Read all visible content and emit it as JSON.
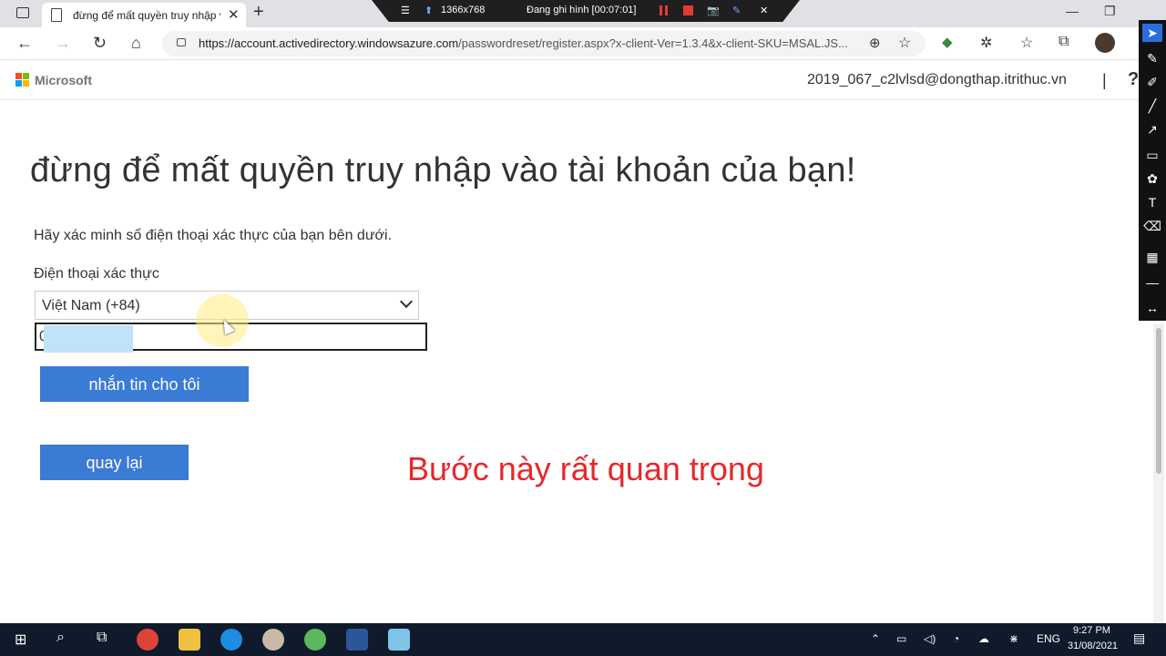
{
  "browser": {
    "tab_title": "đừng để mất quyền truy nhập và",
    "tab_close": "✕",
    "new_tab": "+",
    "url_host": "https://account.activedirectory.windowsazure.com",
    "url_path": "/passwordreset/register.aspx?x-client-Ver=1.3.4&x-client-SKU=MSAL.JS...",
    "icons": [
      "back-icon",
      "forward-icon",
      "refresh-icon",
      "home-icon",
      "lock-icon",
      "zoom-icon",
      "favorite-add-icon",
      "extension-icon",
      "puzzle-icon",
      "favorites-icon",
      "collections-icon",
      "profile-avatar"
    ]
  },
  "recorder": {
    "resolution": "1366x768",
    "status": "Đang ghi hình [00:07:01]"
  },
  "header": {
    "brand": "Microsoft",
    "user_email": "2019_067_c2lvlsd@dongthap.itrithuc.vn",
    "separator": "|",
    "help": "?"
  },
  "main": {
    "heading": "đừng để mất quyền truy nhập vào tài khoản của bạn!",
    "instruction": "Hãy xác minh số điện thoại xác thực của bạn bên dưới.",
    "phone_label": "Điện thoại xác thực",
    "country_selected": "Việt Nam (+84)",
    "phone_value": "0",
    "send_button": "nhắn tin cho tôi",
    "back_button": "quay lại",
    "annotation": "Bước này rất quan trọng"
  },
  "taskbar": {
    "language": "ENG",
    "time": "9:27 PM",
    "date": "31/08/2021"
  },
  "colors": {
    "accent": "#3a7bd5",
    "annotation": "#e5282c",
    "taskbar": "#0f1a2b"
  }
}
